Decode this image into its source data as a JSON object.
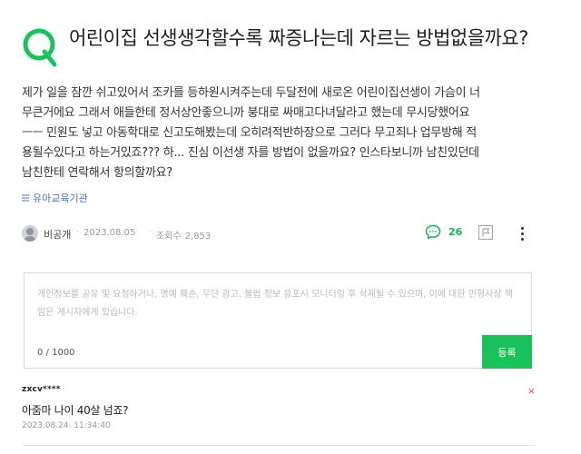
{
  "question": {
    "title": "어린이집 선생생각할수록 짜증나는데 자르는 방법없을까요?",
    "body_lines": [
      "제가 일을 잠깐 쉬고있어서 조카를 등하원시켜주는데 두달전에 새로온 어린이집선생이 가슴이 너",
      "무큰거에요 그래서 애들한테 정서상안좋으니까 붕대로 싸매고다녀달라고 했는데 무시당했어요",
      "ㅡㅡ 민원도 넣고 아동학대로 신고도해봤는데 오히려적반하장으로 그러다 무고죄나 업무방해 적",
      "용될수있다고 하는거있죠??? 하... 진심 이선생 자를 방법이 없을까요? 인스타보니까 남친있던데",
      "남친한테 연락해서 항의할까요?"
    ],
    "category": "유아교육기관"
  },
  "meta": {
    "author": "비공개",
    "date": "2023.08.05",
    "views_label": "조회수",
    "views": "2,853",
    "comment_count": "26"
  },
  "comment_form": {
    "placeholder": "개인정보를 공유 및 요청하거나, 명예 훼손, 무단 광고, 불법 정보 유포시 모니터링 후 삭제될 수 있으며, 이에 대한 민형사상 책임은 게시자에게 있습니다.",
    "char_count": "0 / 1000",
    "submit_label": "등록"
  },
  "replies": [
    {
      "user": "zxcv****",
      "text": "아줌마 나이 40살 넘죠?",
      "date": "2023.08.24. 11:34:40",
      "delete_label": "×"
    }
  ],
  "colors": {
    "accent_green": "#19c35c",
    "category_blue": "#4a74b5",
    "delete_red": "#d9534f"
  },
  "icons": {
    "question_mark": "q-logo-icon",
    "category": "list-icon",
    "comment": "comment-bubble-icon",
    "report": "report-flag-icon",
    "more": "more-vertical-icon"
  }
}
